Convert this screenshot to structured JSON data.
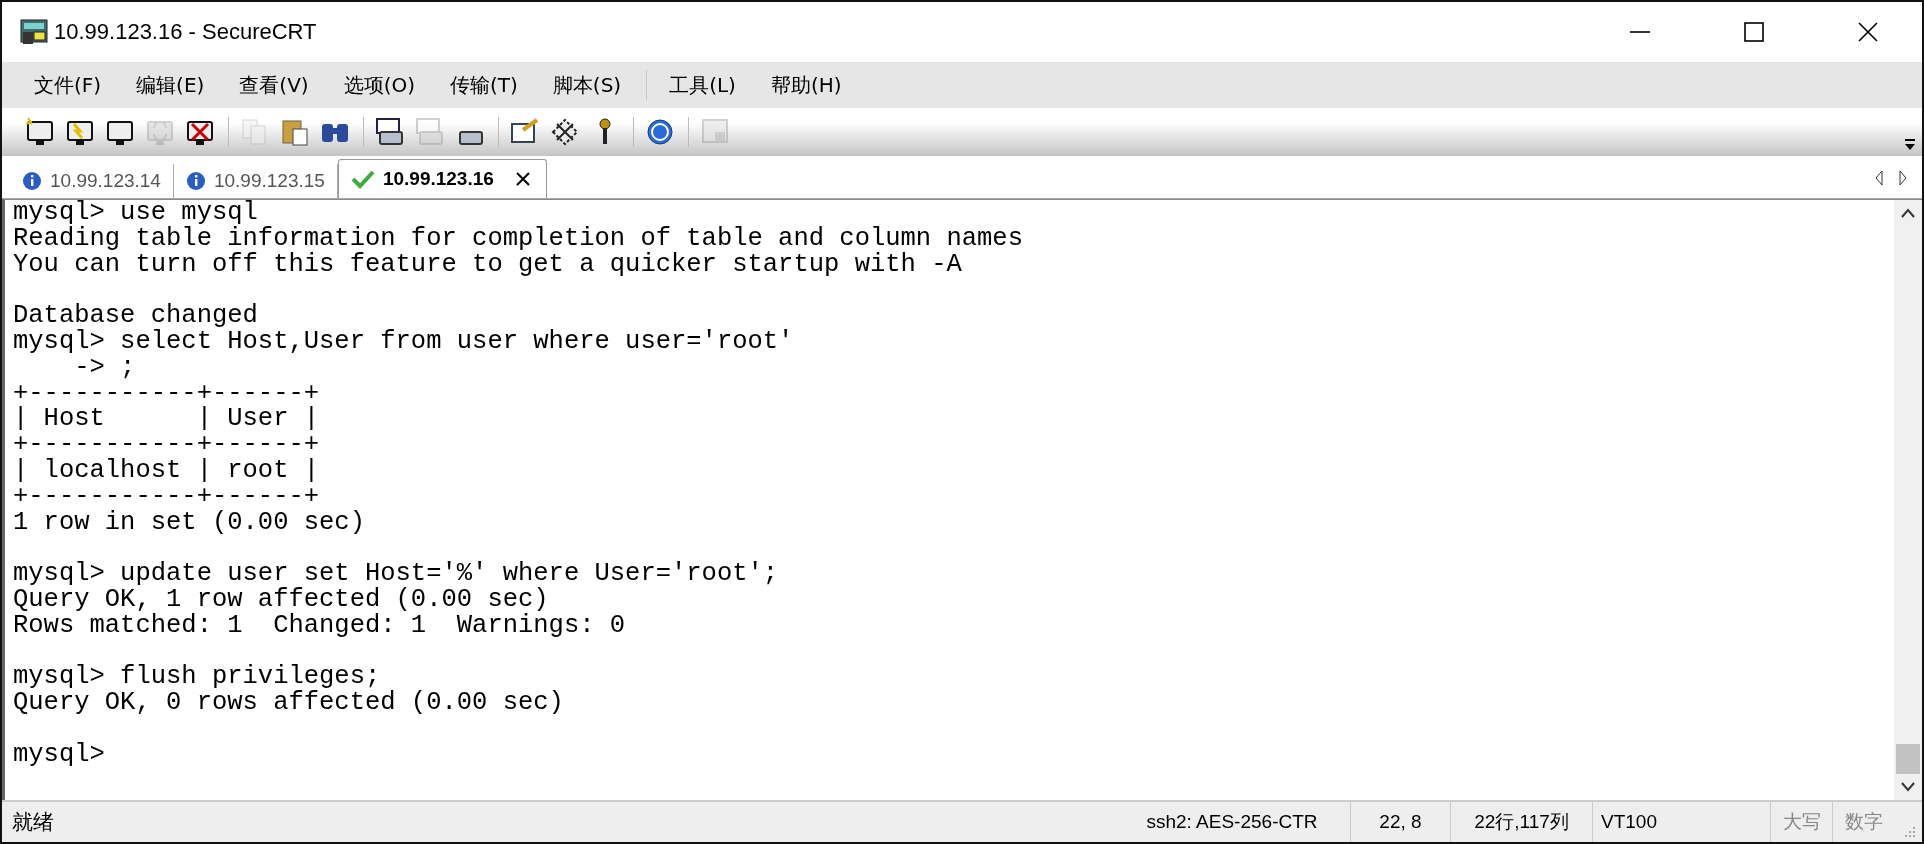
{
  "window": {
    "title": "10.99.123.16 - SecureCRT"
  },
  "menu": [
    "文件(F)",
    "编辑(E)",
    "查看(V)",
    "选项(O)",
    "传输(T)",
    "脚本(S)",
    "工具(L)",
    "帮助(H)"
  ],
  "toolbar": [
    {
      "kind": "quick-connect",
      "disabled": false
    },
    {
      "kind": "connect-tab",
      "disabled": false
    },
    {
      "kind": "connect",
      "disabled": false
    },
    {
      "kind": "reconnect",
      "disabled": true
    },
    {
      "kind": "disconnect",
      "disabled": false
    },
    {
      "kind": "sep"
    },
    {
      "kind": "copy",
      "disabled": true
    },
    {
      "kind": "paste",
      "disabled": false
    },
    {
      "kind": "find",
      "disabled": false
    },
    {
      "kind": "sep"
    },
    {
      "kind": "print-screen",
      "disabled": false
    },
    {
      "kind": "print-selection",
      "disabled": true
    },
    {
      "kind": "print",
      "disabled": false
    },
    {
      "kind": "sep"
    },
    {
      "kind": "options",
      "disabled": false
    },
    {
      "kind": "keymap",
      "disabled": false
    },
    {
      "kind": "key",
      "disabled": false
    },
    {
      "kind": "sep"
    },
    {
      "kind": "help",
      "disabled": false
    },
    {
      "kind": "sep"
    },
    {
      "kind": "lock",
      "disabled": true
    }
  ],
  "tabs": [
    {
      "label": "10.99.123.14",
      "kind": "info",
      "selected": false
    },
    {
      "label": "10.99.123.15",
      "kind": "info",
      "selected": false
    },
    {
      "label": "10.99.123.16",
      "kind": "connected",
      "selected": true
    }
  ],
  "terminal": {
    "blocks": [
      [
        "mysql> use mysql",
        "Reading table information for completion of table and column names",
        "You can turn off this feature to get a quicker startup with -A"
      ],
      [
        "Database changed",
        "mysql> select Host,User from user where user='root'",
        "    -> ;",
        "+-----------+------+",
        "| Host      | User |",
        "+-----------+------+",
        "| localhost | root |",
        "+-----------+------+",
        "1 row in set (0.00 sec)"
      ],
      [
        "mysql> update user set Host='%' where User='root';",
        "Query OK, 1 row affected (0.00 sec)",
        "Rows matched: 1  Changed: 1  Warnings: 0"
      ],
      [
        "mysql> flush privileges;",
        "Query OK, 0 rows affected (0.00 sec)"
      ],
      [
        "mysql>"
      ]
    ]
  },
  "status_bar": {
    "message": "就绪",
    "cells": [
      {
        "text": "ssh2: AES-256-CTR",
        "active": true
      },
      {
        "text": "22,  8",
        "active": true
      },
      {
        "text": "22行,117列",
        "active": true
      },
      {
        "text": "VT100",
        "active": true
      },
      {
        "text": "大写",
        "active": false
      },
      {
        "text": "数字",
        "active": false
      }
    ]
  }
}
